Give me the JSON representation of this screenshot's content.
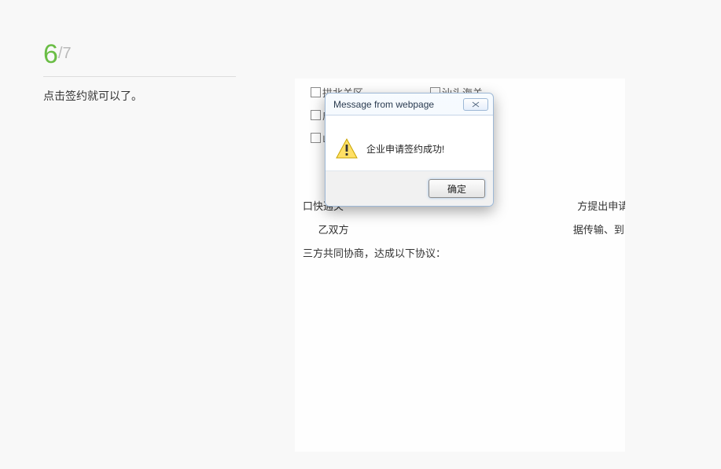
{
  "step": {
    "current": "6",
    "separator": "/",
    "total": "7"
  },
  "instruction": "点击签约就可以了。",
  "checkboxes": {
    "top_left": "拱北关区",
    "mid_left": "成",
    "bot_left": "山",
    "top_right": "汕头海关"
  },
  "agreement": {
    "line1_left": "口快通关",
    "line1_right": "方提出申请",
    "line2_left": "乙双方",
    "line2_right": "据传输、到",
    "line3": "三方共同协商，达成以下协议："
  },
  "dialog": {
    "title": "Message from webpage",
    "message": "企业申请签约成功!",
    "ok": "确定"
  }
}
